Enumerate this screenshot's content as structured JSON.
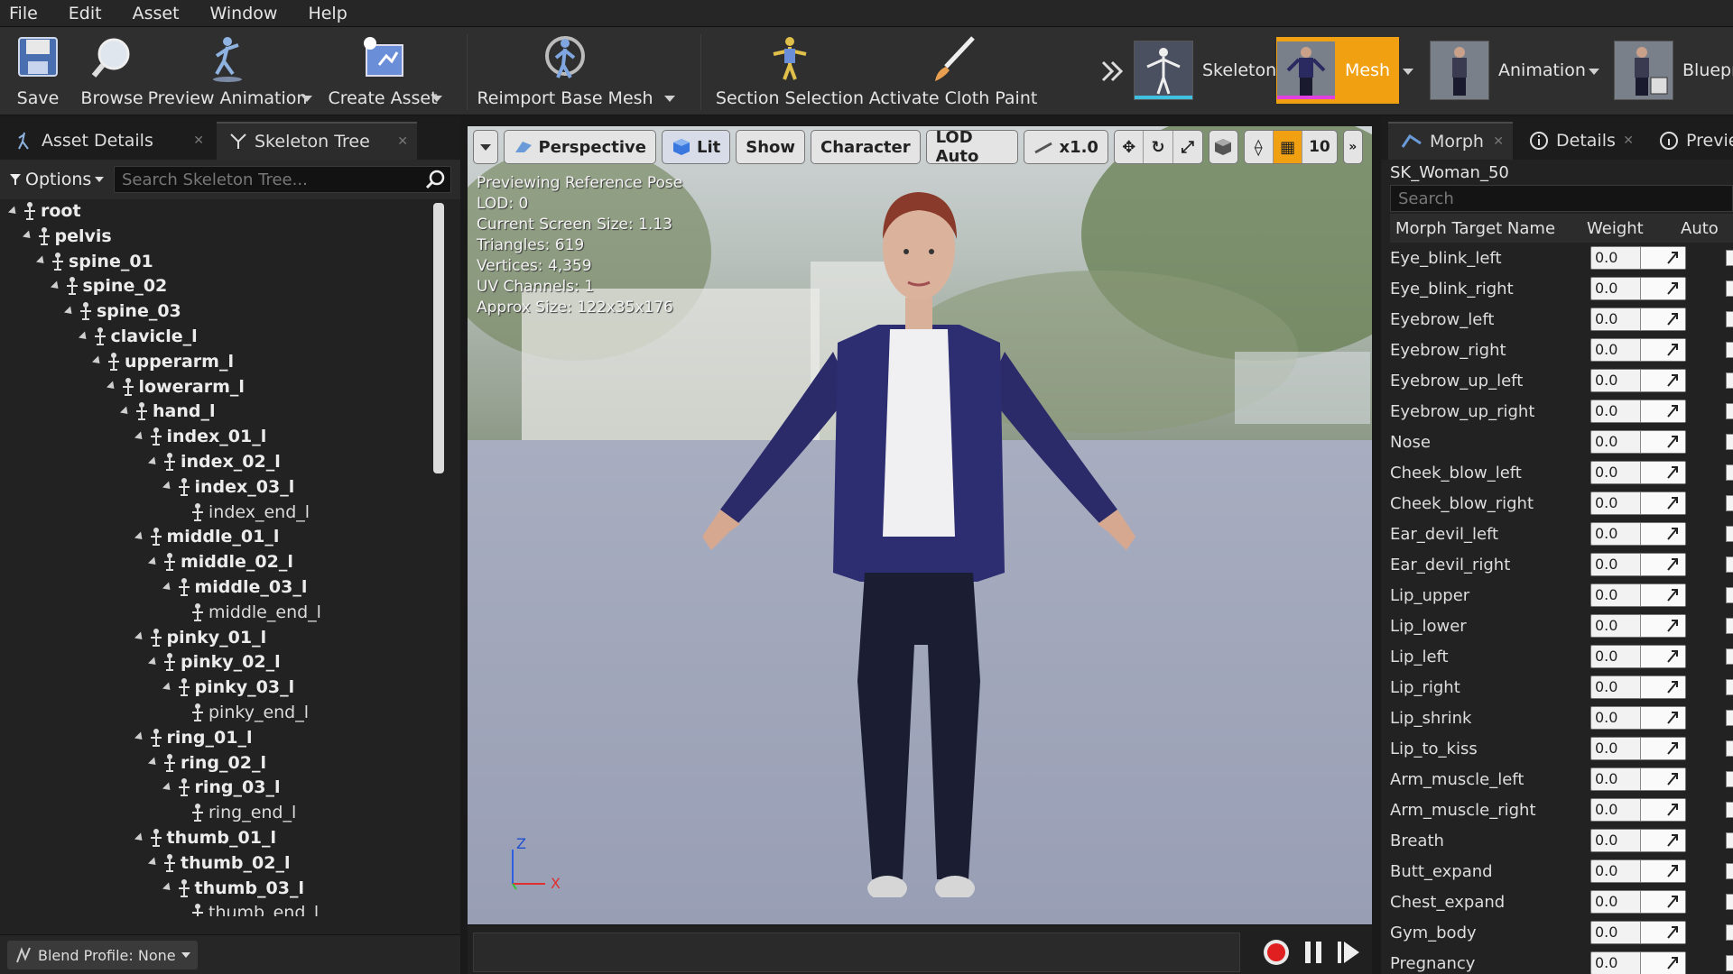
{
  "menu": [
    "File",
    "Edit",
    "Asset",
    "Window",
    "Help"
  ],
  "toolbar": {
    "save": "Save",
    "browse": "Browse",
    "preview_animation": "Preview Animation",
    "create_asset": "Create Asset",
    "reimport": "Reimport Base Mesh",
    "section_selection": "Section Selection",
    "cloth_paint": "Activate Cloth Paint",
    "modes": [
      "Skeleton",
      "Mesh",
      "Animation",
      "Bluepri"
    ],
    "active_mode": "Mesh"
  },
  "left_panel": {
    "tabs": [
      "Asset Details",
      "Skeleton Tree"
    ],
    "options_label": "Options",
    "search_placeholder": "Search Skeleton Tree...",
    "tree": [
      {
        "label": "root",
        "depth": 0
      },
      {
        "label": "pelvis",
        "depth": 1
      },
      {
        "label": "spine_01",
        "depth": 2
      },
      {
        "label": "spine_02",
        "depth": 3
      },
      {
        "label": "spine_03",
        "depth": 4
      },
      {
        "label": "clavicle_l",
        "depth": 5
      },
      {
        "label": "upperarm_l",
        "depth": 6
      },
      {
        "label": "lowerarm_l",
        "depth": 7
      },
      {
        "label": "hand_l",
        "depth": 8
      },
      {
        "label": "index_01_l",
        "depth": 9
      },
      {
        "label": "index_02_l",
        "depth": 10
      },
      {
        "label": "index_03_l",
        "depth": 11
      },
      {
        "label": "index_end_l",
        "depth": 12,
        "leaf": true
      },
      {
        "label": "middle_01_l",
        "depth": 9
      },
      {
        "label": "middle_02_l",
        "depth": 10
      },
      {
        "label": "middle_03_l",
        "depth": 11
      },
      {
        "label": "middle_end_l",
        "depth": 12,
        "leaf": true
      },
      {
        "label": "pinky_01_l",
        "depth": 9
      },
      {
        "label": "pinky_02_l",
        "depth": 10
      },
      {
        "label": "pinky_03_l",
        "depth": 11
      },
      {
        "label": "pinky_end_l",
        "depth": 12,
        "leaf": true
      },
      {
        "label": "ring_01_l",
        "depth": 9
      },
      {
        "label": "ring_02_l",
        "depth": 10
      },
      {
        "label": "ring_03_l",
        "depth": 11
      },
      {
        "label": "ring_end_l",
        "depth": 12,
        "leaf": true
      },
      {
        "label": "thumb_01_l",
        "depth": 9
      },
      {
        "label": "thumb_02_l",
        "depth": 10
      },
      {
        "label": "thumb_03_l",
        "depth": 11
      },
      {
        "label": "thumb_end_l",
        "depth": 12,
        "leaf": true
      }
    ],
    "blend_profile": "Blend Profile: None"
  },
  "viewport": {
    "buttons": {
      "perspective": "Perspective",
      "lit": "Lit",
      "show": "Show",
      "character": "Character",
      "lod": "LOD Auto",
      "speed": "x1.0",
      "grid_value": "10"
    },
    "stats": [
      "Previewing Reference Pose",
      "LOD: 0",
      "Current Screen Size: 1.13",
      "Triangles: 619",
      "Vertices: 4,359",
      "UV Channels: 1",
      "Approx Size: 122x35x176"
    ],
    "axis_z": "Z",
    "axis_x": "X"
  },
  "right_panel": {
    "tabs": [
      "Morph",
      "Details",
      "Previe"
    ],
    "asset_name": "SK_Woman_50",
    "search_placeholder": "Search",
    "columns": [
      "Morph Target Name",
      "Weight",
      "Auto"
    ],
    "rows": [
      {
        "name": "Eye_blink_left",
        "weight": "0.0"
      },
      {
        "name": "Eye_blink_right",
        "weight": "0.0"
      },
      {
        "name": "Eyebrow_left",
        "weight": "0.0"
      },
      {
        "name": "Eyebrow_right",
        "weight": "0.0"
      },
      {
        "name": "Eyebrow_up_left",
        "weight": "0.0"
      },
      {
        "name": "Eyebrow_up_right",
        "weight": "0.0"
      },
      {
        "name": "Nose",
        "weight": "0.0"
      },
      {
        "name": "Cheek_blow_left",
        "weight": "0.0"
      },
      {
        "name": "Cheek_blow_right",
        "weight": "0.0"
      },
      {
        "name": "Ear_devil_left",
        "weight": "0.0"
      },
      {
        "name": "Ear_devil_right",
        "weight": "0.0"
      },
      {
        "name": "Lip_upper",
        "weight": "0.0"
      },
      {
        "name": "Lip_lower",
        "weight": "0.0"
      },
      {
        "name": "Lip_left",
        "weight": "0.0"
      },
      {
        "name": "Lip_right",
        "weight": "0.0"
      },
      {
        "name": "Lip_shrink",
        "weight": "0.0"
      },
      {
        "name": "Lip_to_kiss",
        "weight": "0.0"
      },
      {
        "name": "Arm_muscle_left",
        "weight": "0.0"
      },
      {
        "name": "Arm_muscle_right",
        "weight": "0.0"
      },
      {
        "name": "Breath",
        "weight": "0.0"
      },
      {
        "name": "Butt_expand",
        "weight": "0.0"
      },
      {
        "name": "Chest_expand",
        "weight": "0.0"
      },
      {
        "name": "Gym_body",
        "weight": "0.0"
      },
      {
        "name": "Pregnancy",
        "weight": "0.0"
      }
    ]
  },
  "colors": {
    "accent": "#f0a010",
    "record": "#e02020"
  }
}
